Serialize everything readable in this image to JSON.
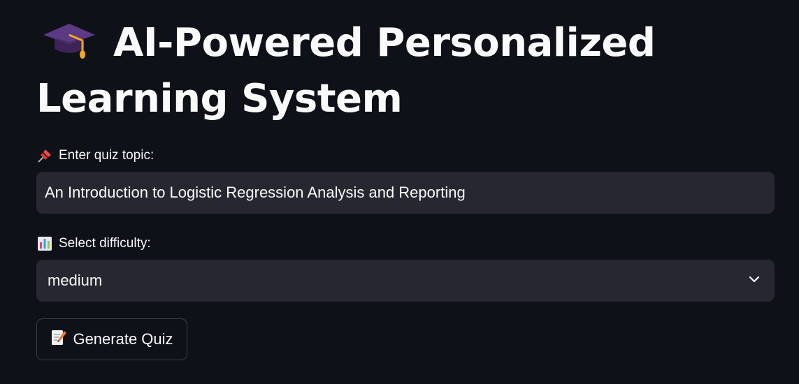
{
  "app": {
    "title": "AI-Powered Personalized Learning System",
    "title_icon": "graduation-cap-icon"
  },
  "topic": {
    "label": "Enter quiz topic:",
    "label_icon": "pushpin-icon",
    "value": "An Introduction to Logistic Regression Analysis and Reporting"
  },
  "difficulty": {
    "label": "Select difficulty:",
    "label_icon": "bar-chart-icon",
    "selected": "medium",
    "dropdown_icon": "chevron-down-icon"
  },
  "generate": {
    "label": "Generate Quiz",
    "icon": "memo-icon"
  },
  "colors": {
    "background": "#0e1117",
    "input_background": "#262730",
    "text": "#fafafa",
    "button_border": "#3b3e47"
  }
}
